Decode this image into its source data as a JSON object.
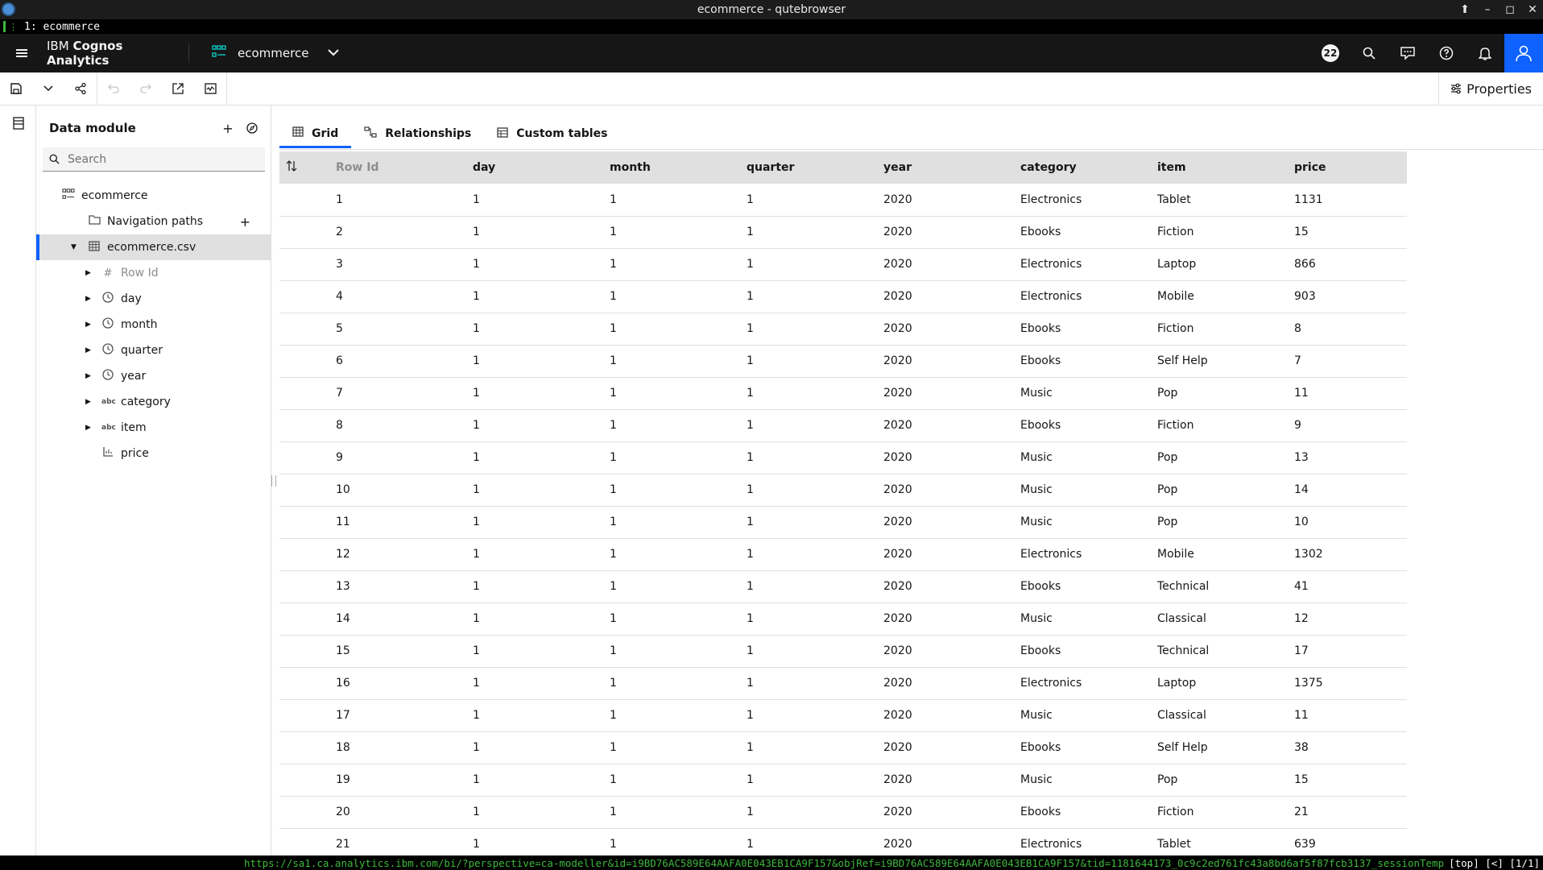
{
  "window": {
    "title": "ecommerce - qutebrowser",
    "controls": [
      "⬆",
      "–",
      "◻",
      "✕"
    ]
  },
  "browser_tab": {
    "label": "1: ecommerce"
  },
  "header": {
    "product_prefix": "IBM ",
    "product_name": "Cognos Analytics",
    "module_name": "ecommerce",
    "notification_count": "22"
  },
  "toolbar": {
    "properties_label": "Properties"
  },
  "panel": {
    "title": "Data module",
    "search_placeholder": "Search",
    "tree": {
      "root": "ecommerce",
      "navigation_paths": "Navigation paths",
      "table": "ecommerce.csv",
      "fields": [
        "Row Id",
        "day",
        "month",
        "quarter",
        "year",
        "category",
        "item",
        "price"
      ]
    }
  },
  "tabs": [
    "Grid",
    "Relationships",
    "Custom tables"
  ],
  "grid": {
    "columns": [
      "Row Id",
      "day",
      "month",
      "quarter",
      "year",
      "category",
      "item",
      "price"
    ],
    "rows": [
      [
        "1",
        "1",
        "1",
        "1",
        "2020",
        "Electronics",
        "Tablet",
        "1131"
      ],
      [
        "2",
        "1",
        "1",
        "1",
        "2020",
        "Ebooks",
        "Fiction",
        "15"
      ],
      [
        "3",
        "1",
        "1",
        "1",
        "2020",
        "Electronics",
        "Laptop",
        "866"
      ],
      [
        "4",
        "1",
        "1",
        "1",
        "2020",
        "Electronics",
        "Mobile",
        "903"
      ],
      [
        "5",
        "1",
        "1",
        "1",
        "2020",
        "Ebooks",
        "Fiction",
        "8"
      ],
      [
        "6",
        "1",
        "1",
        "1",
        "2020",
        "Ebooks",
        "Self Help",
        "7"
      ],
      [
        "7",
        "1",
        "1",
        "1",
        "2020",
        "Music",
        "Pop",
        "11"
      ],
      [
        "8",
        "1",
        "1",
        "1",
        "2020",
        "Ebooks",
        "Fiction",
        "9"
      ],
      [
        "9",
        "1",
        "1",
        "1",
        "2020",
        "Music",
        "Pop",
        "13"
      ],
      [
        "10",
        "1",
        "1",
        "1",
        "2020",
        "Music",
        "Pop",
        "14"
      ],
      [
        "11",
        "1",
        "1",
        "1",
        "2020",
        "Music",
        "Pop",
        "10"
      ],
      [
        "12",
        "1",
        "1",
        "1",
        "2020",
        "Electronics",
        "Mobile",
        "1302"
      ],
      [
        "13",
        "1",
        "1",
        "1",
        "2020",
        "Ebooks",
        "Technical",
        "41"
      ],
      [
        "14",
        "1",
        "1",
        "1",
        "2020",
        "Music",
        "Classical",
        "12"
      ],
      [
        "15",
        "1",
        "1",
        "1",
        "2020",
        "Ebooks",
        "Technical",
        "17"
      ],
      [
        "16",
        "1",
        "1",
        "1",
        "2020",
        "Electronics",
        "Laptop",
        "1375"
      ],
      [
        "17",
        "1",
        "1",
        "1",
        "2020",
        "Music",
        "Classical",
        "11"
      ],
      [
        "18",
        "1",
        "1",
        "1",
        "2020",
        "Ebooks",
        "Self Help",
        "38"
      ],
      [
        "19",
        "1",
        "1",
        "1",
        "2020",
        "Music",
        "Pop",
        "15"
      ],
      [
        "20",
        "1",
        "1",
        "1",
        "2020",
        "Ebooks",
        "Fiction",
        "21"
      ],
      [
        "21",
        "1",
        "1",
        "1",
        "2020",
        "Electronics",
        "Tablet",
        "639"
      ]
    ]
  },
  "statusbar": {
    "url": "https://sa1.ca.analytics.ibm.com/bi/?perspective=ca-modeller&id=i9BD76AC589E64AAFA0E043EB1CA9F157&objRef=i9BD76AC589E64AAFA0E043EB1CA9F157&tid=1181644173_0c9c2ed761fc43a8bd6af5f87fcb3137_sessionTemp",
    "position": "[top] [<] [1/1]"
  },
  "colors": {
    "accent": "#0f62fe",
    "header_bg": "#161616",
    "teal": "#08bdba",
    "status_green": "#3db83d"
  },
  "icons": {
    "field_types": [
      "hash-icon",
      "clock-icon",
      "clock-icon",
      "clock-icon",
      "clock-icon",
      "text-abc-icon",
      "text-abc-icon",
      "measure-icon"
    ]
  }
}
